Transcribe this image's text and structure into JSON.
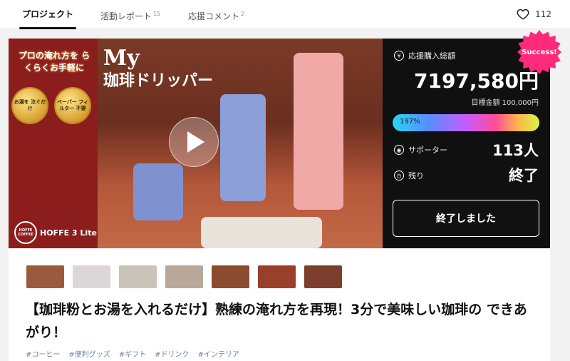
{
  "tabs": [
    {
      "label": "プロジェクト",
      "count": "",
      "active": true
    },
    {
      "label": "活動レポート",
      "count": "15",
      "active": false
    },
    {
      "label": "応援コメント",
      "count": "2",
      "active": false
    }
  ],
  "like_count": "112",
  "hero": {
    "promo_text": "プロの淹れ方を らくらくお手軽に",
    "medal_1": "お湯を 注ぐだけ",
    "medal_2": "ペーパー フィルター 不要",
    "brand": "HOFFE 3 Lite",
    "brand_mark": "HOFFE COFFEE",
    "title_my": "My",
    "title_sub": "珈琲ドリッパー"
  },
  "stats": {
    "badge": "Success!",
    "total_label": "応援購入総額",
    "total_amount": "7197,580円",
    "goal_text": "目標金額 100,000円",
    "progress_percent": "197%",
    "progress_value": 197,
    "supporters_label": "サポーター",
    "supporters_value": "113人",
    "remaining_label": "残り",
    "remaining_value": "終了",
    "ended_button": "終了しました"
  },
  "thumbnails": [
    {
      "name": "thumbnail-1",
      "color": "#9b5a3e"
    },
    {
      "name": "thumbnail-2",
      "color": "#dcd6d8"
    },
    {
      "name": "thumbnail-3",
      "color": "#c9c3b8"
    },
    {
      "name": "thumbnail-4",
      "color": "#b7a89a"
    },
    {
      "name": "thumbnail-5",
      "color": "#8a4b2e"
    },
    {
      "name": "thumbnail-6",
      "color": "#9a3f2a"
    },
    {
      "name": "thumbnail-7",
      "color": "#7d3f2d"
    }
  ],
  "headline": "【珈琲粉とお湯を入れるだけ】熟練の淹れ方を再現！3分で美味しい珈琲の できあがり！",
  "tags": [
    "#コーヒー",
    "#便利グッズ",
    "#ギフト",
    "#ドリンク",
    "#インテリア"
  ],
  "colors": {
    "promo_red": "#8b1d1d",
    "success_pink": "#ff2b7a",
    "panel_black": "#101010"
  }
}
